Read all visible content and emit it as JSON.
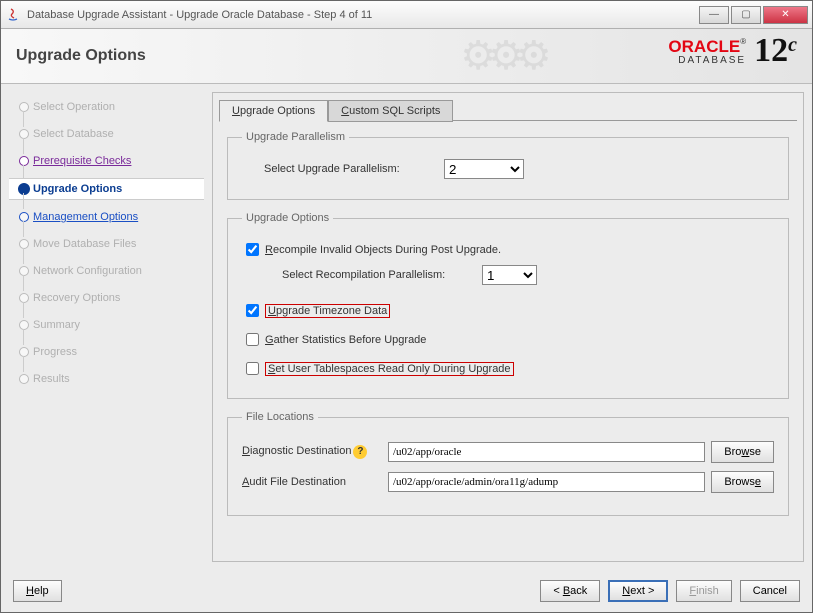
{
  "window_title": "Database Upgrade Assistant - Upgrade Oracle Database - Step 4 of 11",
  "brand": {
    "oracle": "ORACLE",
    "database": "DATABASE",
    "version": "12",
    "suffix": "c"
  },
  "page_title": "Upgrade Options",
  "steps": [
    {
      "label": "Select Operation",
      "state": "disabled"
    },
    {
      "label": "Select Database",
      "state": "disabled"
    },
    {
      "label": "Prerequisite Checks",
      "state": "done"
    },
    {
      "label": "Upgrade Options",
      "state": "current"
    },
    {
      "label": "Management Options",
      "state": "next"
    },
    {
      "label": "Move Database Files",
      "state": "disabled"
    },
    {
      "label": "Network Configuration",
      "state": "disabled"
    },
    {
      "label": "Recovery Options",
      "state": "disabled"
    },
    {
      "label": "Summary",
      "state": "disabled"
    },
    {
      "label": "Progress",
      "state": "disabled"
    },
    {
      "label": "Results",
      "state": "disabled"
    }
  ],
  "tabs": {
    "upgrade_options": "Upgrade Options",
    "custom_sql": "Custom SQL Scripts"
  },
  "parallelism": {
    "legend": "Upgrade Parallelism",
    "label": "Select Upgrade Parallelism:",
    "value": "2"
  },
  "upgrade_options": {
    "legend": "Upgrade Options",
    "recompile_label": "Recompile Invalid Objects During Post Upgrade.",
    "recompile_parallel_label": "Select Recompilation Parallelism:",
    "recompile_parallel_value": "1",
    "upgrade_tz_label": "Upgrade Timezone Data",
    "gather_stats_label": "Gather Statistics Before Upgrade",
    "readonly_label": "Set User Tablespaces Read Only During Upgrade"
  },
  "file_locations": {
    "legend": "File Locations",
    "diag_label": "Diagnostic Destination",
    "diag_value": "/u02/app/oracle",
    "audit_label": "Audit File Destination",
    "audit_value": "/u02/app/oracle/admin/ora11g/adump",
    "browse": "Browse"
  },
  "footer": {
    "help": "Help",
    "back": "< Back",
    "next": "Next >",
    "finish": "Finish",
    "cancel": "Cancel"
  }
}
